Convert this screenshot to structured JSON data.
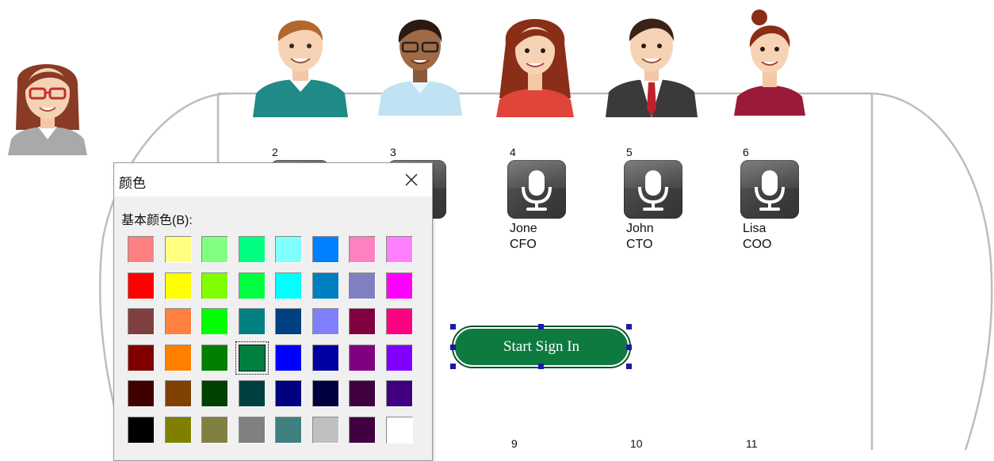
{
  "seats_top": [
    {
      "number": "2",
      "name": "",
      "role": ""
    },
    {
      "number": "3",
      "name": "",
      "role": ""
    },
    {
      "number": "4",
      "name": "Jone",
      "role": "CFO"
    },
    {
      "number": "5",
      "name": "John",
      "role": "CTO"
    },
    {
      "number": "6",
      "name": "Lisa",
      "role": "COO"
    }
  ],
  "seats_bottom": [
    {
      "number": "9"
    },
    {
      "number": "10"
    },
    {
      "number": "11"
    }
  ],
  "start_button": {
    "label": "Start Sign In",
    "color": "#0e7a3f"
  },
  "color_dialog": {
    "title": "颜色",
    "basic_colors_label": "基本颜色(B):",
    "selected_color": "#008040",
    "basic_colors": [
      [
        "#ff8080",
        "#ffff80",
        "#80ff80",
        "#00ff80",
        "#80ffff",
        "#0080ff",
        "#ff80c0",
        "#ff80ff"
      ],
      [
        "#ff0000",
        "#ffff00",
        "#80ff00",
        "#00ff40",
        "#00ffff",
        "#0080c0",
        "#8080c0",
        "#ff00ff"
      ],
      [
        "#804040",
        "#ff8040",
        "#00ff00",
        "#008080",
        "#004080",
        "#8080ff",
        "#800040",
        "#ff0080"
      ],
      [
        "#800000",
        "#ff8000",
        "#008000",
        "#008040",
        "#0000ff",
        "#0000a0",
        "#800080",
        "#8000ff"
      ],
      [
        "#400000",
        "#804000",
        "#004000",
        "#004040",
        "#000080",
        "#000040",
        "#400040",
        "#400080"
      ],
      [
        "#000000",
        "#808000",
        "#808040",
        "#808080",
        "#408080",
        "#c0c0c0",
        "#400040",
        "#ffffff"
      ]
    ]
  }
}
